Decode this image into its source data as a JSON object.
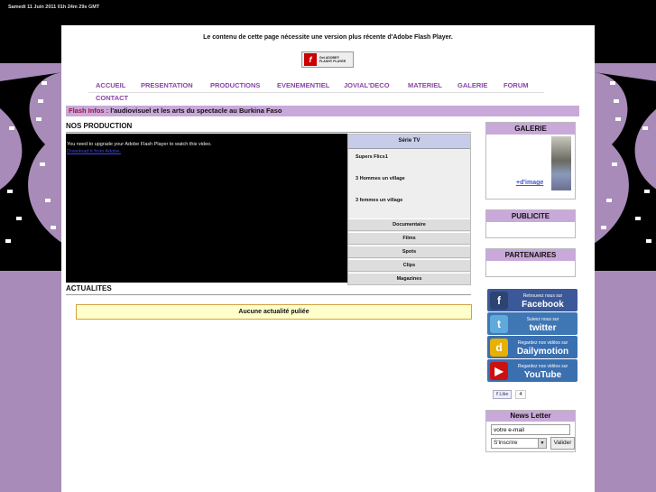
{
  "header": {
    "date": "Samedi 11 Juin 2011 01h 24m 29s GMT"
  },
  "flash_notice": {
    "message": "Le contenu de cette page nécessite une version plus récente d'Adobe Flash Player.",
    "badge_line1": "Get ADOBE®",
    "badge_line2": "FLASH® PLAYER"
  },
  "nav": {
    "items": [
      "ACCUEIL",
      "PRESENTATION",
      "PRODUCTIONS",
      "EVENEMENTIEL",
      "JOVIAL'DECO",
      "MATERIEL",
      "GALERIE",
      "FORUM",
      "CONTACT"
    ]
  },
  "flash_infos": {
    "label": "Flash Infos :",
    "text": "l'audiovisuel et les arts du spectacle au Burkina Faso"
  },
  "productions": {
    "title": "NOS PRODUCTION",
    "video_message": "You need to upgrade your Adobe Flash Player to watch this video.",
    "video_link": "Download it from Adobe.",
    "series_head": "Série TV",
    "episodes": [
      "Supers Flics1",
      "3 Hommes un village",
      "3 femmes un village"
    ],
    "categories": [
      "Documentaire",
      "Films",
      "Spots",
      "Clips",
      "Magazines"
    ]
  },
  "actualites": {
    "title": "ACTUALITES",
    "empty": "Aucune actualité puliée"
  },
  "sidebar": {
    "galerie_title": "GALERIE",
    "galerie_link": "+d'image",
    "publicite_title": "PUBLICITE",
    "partenaires_title": "PARTENAIRES",
    "social": [
      {
        "small": "Retrouvez nous sur",
        "big": "Facebook",
        "color": "#3b5998",
        "icon": "f"
      },
      {
        "small": "Suivez nous sur",
        "big": "twitter",
        "color": "#3f77b5",
        "icon": "t"
      },
      {
        "small": "Regardez nos vidéos sur",
        "big": "Dailymotion",
        "color": "#3a6fb0",
        "icon": "d"
      },
      {
        "small": "Regardez nos vidéos sur",
        "big": "YouTube",
        "color": "#3a6fb0",
        "icon": "y"
      }
    ],
    "like_label": "Like",
    "like_count": "4"
  },
  "newsletter": {
    "title": "News Letter",
    "email_value": "votre e-mail",
    "select_value": "S'inscrire",
    "submit_label": "Valider"
  }
}
